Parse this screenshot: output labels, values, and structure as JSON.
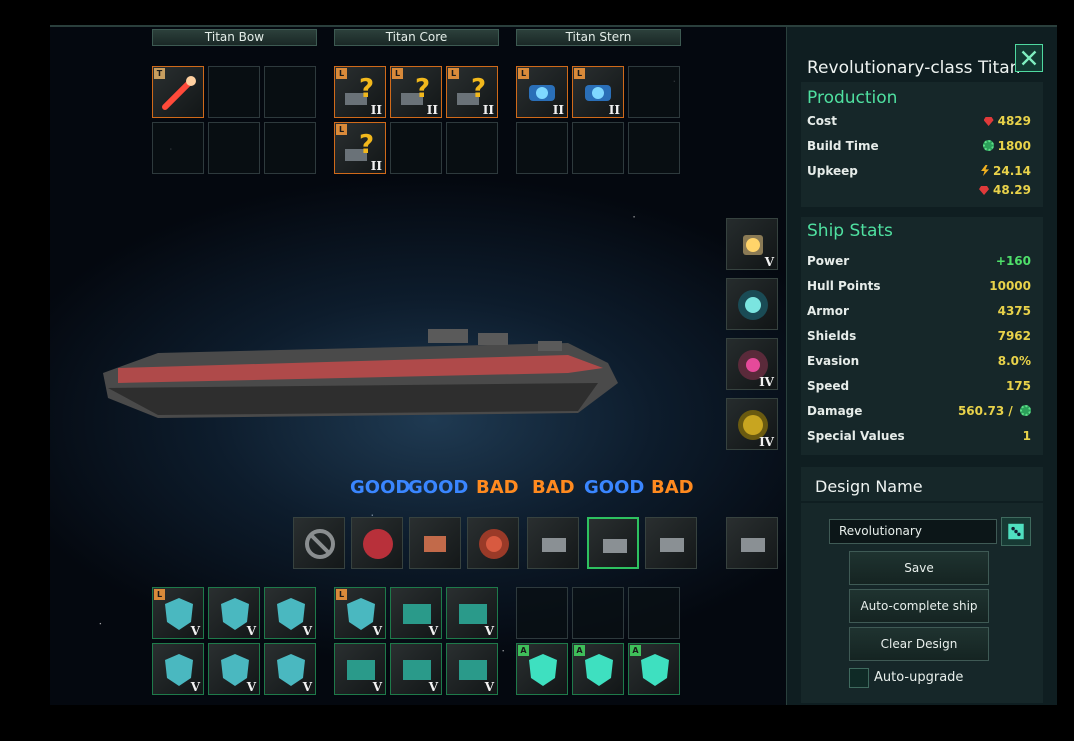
{
  "sections": {
    "bow": "Titan Bow",
    "core": "Titan Core",
    "stern": "Titan Stern"
  },
  "ranks": {
    "two": "II",
    "four": "IV",
    "five": "V"
  },
  "tags": {
    "large": "L",
    "titan": "T",
    "auxiliary": "A"
  },
  "verdicts": [
    "GOOD",
    "GOOD",
    "BAD",
    "BAD",
    "GOOD",
    "BAD"
  ],
  "panel": {
    "title": "Revolutionary-class Titan",
    "production_heading": "Production",
    "cost_label": "Cost",
    "cost_value": "4829",
    "build_label": "Build Time",
    "build_value": "1800",
    "upkeep_label": "Upkeep",
    "upkeep_energy": "24.14",
    "upkeep_minerals": "48.29",
    "stats_heading": "Ship Stats",
    "power_label": "Power",
    "power_value": "+160",
    "hull_label": "Hull Points",
    "hull_value": "10000",
    "armor_label": "Armor",
    "armor_value": "4375",
    "shields_label": "Shields",
    "shields_value": "7962",
    "evasion_label": "Evasion",
    "evasion_value": "8.0%",
    "speed_label": "Speed",
    "speed_value": "175",
    "damage_label": "Damage",
    "damage_value": "560.73 /",
    "special_label": "Special Values",
    "special_value": "1",
    "design_heading": "Design Name",
    "design_name": "Revolutionary",
    "save_label": "Save",
    "autocomplete_label": "Auto-complete ship",
    "clear_label": "Clear Design",
    "autoupgrade_label": "Auto-upgrade"
  },
  "colors": {
    "accent": "#4fe0a0",
    "value": "#e8d24a",
    "good": "#3a86ff",
    "bad": "#ff8a1f",
    "selected": "#2ec160",
    "panel": "#0f1e21"
  },
  "icons": [
    "close-icon",
    "perdition-beam-icon",
    "question-module-icon",
    "ion-cannon-icon",
    "energy-core-icon",
    "aura-device-icon",
    "torpedo-icon",
    "radar-icon",
    "no-component-icon",
    "nanite-icon",
    "thruster-icon",
    "turret-icon",
    "shield-icon",
    "armor-plate-icon",
    "aux-shield-icon",
    "dice-icon",
    "gem-icon",
    "gear-icon",
    "bolt-icon"
  ]
}
